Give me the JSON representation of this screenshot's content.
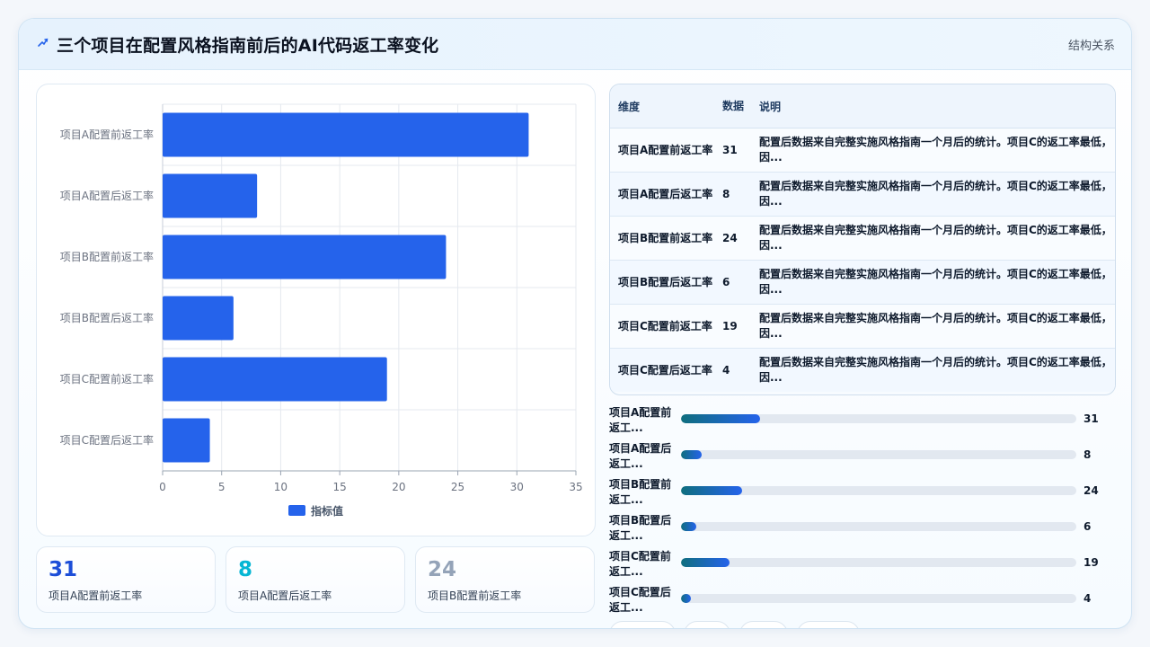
{
  "header": {
    "title": "三个项目在配置风格指南前后的AI代码返工率变化",
    "struct_link": "结构关系"
  },
  "chart_data": {
    "type": "bar",
    "orientation": "horizontal",
    "categories": [
      "项目A配置前返工率",
      "项目A配置后返工率",
      "项目B配置前返工率",
      "项目B配置后返工率",
      "项目C配置前返工率",
      "项目C配置后返工率"
    ],
    "series": [
      {
        "name": "指标值",
        "values": [
          31,
          8,
          24,
          6,
          19,
          4
        ]
      }
    ],
    "x_ticks": [
      "0",
      "5",
      "10",
      "15",
      "20",
      "25",
      "30",
      "35"
    ],
    "xlim": [
      0,
      35
    ],
    "grid": true,
    "legend": "bottom",
    "bar_color": "#2563eb"
  },
  "stats": [
    {
      "value": "31",
      "label": "项目A配置前返工率",
      "color": "#1d4ed8"
    },
    {
      "value": "8",
      "label": "项目A配置后返工率",
      "color": "#06b6d4"
    },
    {
      "value": "24",
      "label": "项目B配置前返工率",
      "color": "#94a3b8"
    }
  ],
  "table": {
    "headers": [
      "维度",
      "数据",
      "说明"
    ],
    "rows": [
      {
        "dim": "项目A配置前返工率",
        "val": "31",
        "desc": "配置后数据来自完整实施风格指南一个月后的统计。项目C的返工率最低，因..."
      },
      {
        "dim": "项目A配置后返工率",
        "val": "8",
        "desc": "配置后数据来自完整实施风格指南一个月后的统计。项目C的返工率最低，因..."
      },
      {
        "dim": "项目B配置前返工率",
        "val": "24",
        "desc": "配置后数据来自完整实施风格指南一个月后的统计。项目C的返工率最低，因..."
      },
      {
        "dim": "项目B配置后返工率",
        "val": "6",
        "desc": "配置后数据来自完整实施风格指南一个月后的统计。项目C的返工率最低，因..."
      },
      {
        "dim": "项目C配置前返工率",
        "val": "19",
        "desc": "配置后数据来自完整实施风格指南一个月后的统计。项目C的返工率最低，因..."
      },
      {
        "dim": "项目C配置后返工率",
        "val": "4",
        "desc": "配置后数据来自完整实施风格指南一个月后的统计。项目C的返工率最低，因..."
      }
    ]
  },
  "progress": {
    "max": 155,
    "items": [
      {
        "label": "项目A配置前返工...",
        "value": 31
      },
      {
        "label": "项目A配置后返工...",
        "value": 8
      },
      {
        "label": "项目B配置前返工...",
        "value": 24
      },
      {
        "label": "项目B配置后返工...",
        "value": 6
      },
      {
        "label": "项目C配置前返工...",
        "value": 19
      },
      {
        "label": "项目C配置后返工...",
        "value": 4
      }
    ]
  }
}
